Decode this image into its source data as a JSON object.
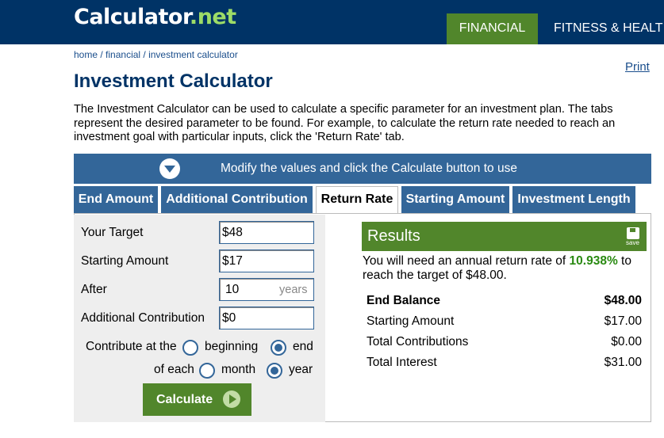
{
  "header": {
    "logo_main": "Calculator",
    "logo_dot": ".",
    "logo_net": "net",
    "nav": [
      "FINANCIAL",
      "FITNESS & HEALT"
    ]
  },
  "breadcrumb": {
    "home": "home",
    "sep1": " / ",
    "financial": "financial",
    "sep2": " / ",
    "current": "investment calculator"
  },
  "print_label": "Print",
  "page_title": "Investment Calculator",
  "description": "The Investment Calculator can be used to calculate a specific parameter for an investment plan. The tabs represent the desired parameter to be found. For example, to calculate the return rate needed to reach an investment goal with particular inputs, click the 'Return Rate' tab.",
  "banner_text": "Modify the values and click the Calculate button to use",
  "tabs": [
    "End Amount",
    "Additional Contribution",
    "Return Rate",
    "Starting Amount",
    "Investment Length"
  ],
  "active_tab": "Return Rate",
  "form": {
    "target_label": "Your Target",
    "target_value": "$48",
    "starting_label": "Starting Amount",
    "starting_value": "$17",
    "after_label": "After",
    "after_value": "10",
    "after_suffix": "years",
    "contribution_label": "Additional Contribution",
    "contribution_value": "$0",
    "contribute_at_label": "Contribute at the",
    "contribute_at_options": [
      "beginning",
      "end"
    ],
    "contribute_at_selected": "end",
    "of_each_label": "of each",
    "of_each_options": [
      "month",
      "year"
    ],
    "of_each_selected": "year",
    "calculate_label": "Calculate"
  },
  "results": {
    "title": "Results",
    "save_label": "save",
    "sentence_pre": "You will need an annual return rate of ",
    "rate": "10.938%",
    "sentence_post": " to reach the target of $48.00.",
    "rows": [
      {
        "label": "End Balance",
        "value": "$48.00"
      },
      {
        "label": "Starting Amount",
        "value": "$17.00"
      },
      {
        "label": "Total Contributions",
        "value": "$0.00"
      },
      {
        "label": "Total Interest",
        "value": "$31.00"
      }
    ]
  },
  "colors": {
    "header_bg": "#003366",
    "accent_green": "#51862b",
    "tab_blue": "#336699",
    "rate_green": "#2a8a12"
  }
}
